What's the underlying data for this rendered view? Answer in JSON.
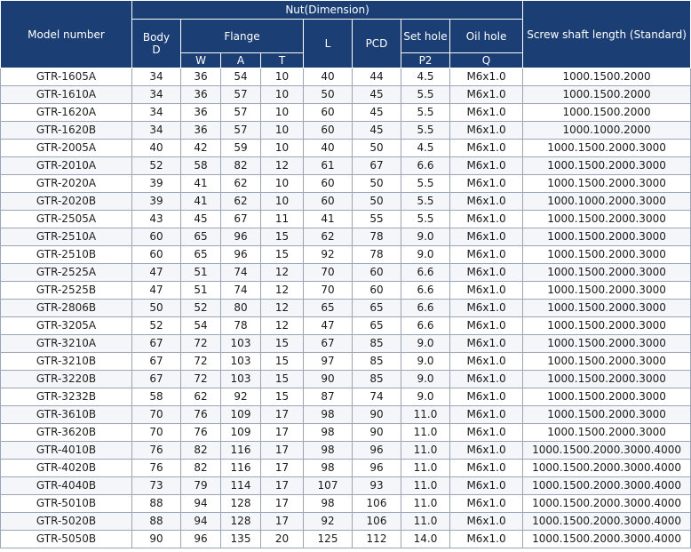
{
  "header": {
    "model_number": "Model number",
    "nut_dimension": "Nut(Dimension)",
    "body": "Body",
    "body_sub": "D",
    "flange": "Flange",
    "flange_w": "W",
    "flange_a": "A",
    "flange_t": "T",
    "l": "L",
    "pcd": "PCD",
    "set_hole": "Set hole",
    "set_hole_sub": "P2",
    "oil_hole": "Oil hole",
    "oil_hole_sub": "Q",
    "screw_shaft": "Screw shaft length (Standard)"
  },
  "rows": [
    {
      "model": "GTR-1605A",
      "d": "34",
      "w": "36",
      "a": "54",
      "t": "10",
      "l": "40",
      "pcd": "44",
      "p2": "4.5",
      "q": "M6x1.0",
      "len": "1000.1500.2000"
    },
    {
      "model": "GTR-1610A",
      "d": "34",
      "w": "36",
      "a": "57",
      "t": "10",
      "l": "50",
      "pcd": "45",
      "p2": "5.5",
      "q": "M6x1.0",
      "len": "1000.1500.2000"
    },
    {
      "model": "GTR-1620A",
      "d": "34",
      "w": "36",
      "a": "57",
      "t": "10",
      "l": "60",
      "pcd": "45",
      "p2": "5.5",
      "q": "M6x1.0",
      "len": "1000.1500.2000"
    },
    {
      "model": "GTR-1620B",
      "d": "34",
      "w": "36",
      "a": "57",
      "t": "10",
      "l": "60",
      "pcd": "45",
      "p2": "5.5",
      "q": "M6x1.0",
      "len": "1000.1000.2000"
    },
    {
      "model": "GTR-2005A",
      "d": "40",
      "w": "42",
      "a": "59",
      "t": "10",
      "l": "40",
      "pcd": "50",
      "p2": "4.5",
      "q": "M6x1.0",
      "len": "1000.1500.2000.3000"
    },
    {
      "model": "GTR-2010A",
      "d": "52",
      "w": "58",
      "a": "82",
      "t": "12",
      "l": "61",
      "pcd": "67",
      "p2": "6.6",
      "q": "M6x1.0",
      "len": "1000.1500.2000.3000"
    },
    {
      "model": "GTR-2020A",
      "d": "39",
      "w": "41",
      "a": "62",
      "t": "10",
      "l": "60",
      "pcd": "50",
      "p2": "5.5",
      "q": "M6x1.0",
      "len": "1000.1500.2000.3000"
    },
    {
      "model": "GTR-2020B",
      "d": "39",
      "w": "41",
      "a": "62",
      "t": "10",
      "l": "60",
      "pcd": "50",
      "p2": "5.5",
      "q": "M6x1.0",
      "len": "1000.1000.2000.3000"
    },
    {
      "model": "GTR-2505A",
      "d": "43",
      "w": "45",
      "a": "67",
      "t": "11",
      "l": "41",
      "pcd": "55",
      "p2": "5.5",
      "q": "M6x1.0",
      "len": "1000.1500.2000.3000"
    },
    {
      "model": "GTR-2510A",
      "d": "60",
      "w": "65",
      "a": "96",
      "t": "15",
      "l": "62",
      "pcd": "78",
      "p2": "9.0",
      "q": "M6x1.0",
      "len": "1000.1500.2000.3000"
    },
    {
      "model": "GTR-2510B",
      "d": "60",
      "w": "65",
      "a": "96",
      "t": "15",
      "l": "92",
      "pcd": "78",
      "p2": "9.0",
      "q": "M6x1.0",
      "len": "1000.1500.2000.3000"
    },
    {
      "model": "GTR-2525A",
      "d": "47",
      "w": "51",
      "a": "74",
      "t": "12",
      "l": "70",
      "pcd": "60",
      "p2": "6.6",
      "q": "M6x1.0",
      "len": "1000.1500.2000.3000"
    },
    {
      "model": "GTR-2525B",
      "d": "47",
      "w": "51",
      "a": "74",
      "t": "12",
      "l": "70",
      "pcd": "60",
      "p2": "6.6",
      "q": "M6x1.0",
      "len": "1000.1500.2000.3000"
    },
    {
      "model": "GTR-2806B",
      "d": "50",
      "w": "52",
      "a": "80",
      "t": "12",
      "l": "65",
      "pcd": "65",
      "p2": "6.6",
      "q": "M6x1.0",
      "len": "1000.1500.2000.3000"
    },
    {
      "model": "GTR-3205A",
      "d": "52",
      "w": "54",
      "a": "78",
      "t": "12",
      "l": "47",
      "pcd": "65",
      "p2": "6.6",
      "q": "M6x1.0",
      "len": "1000.1500.2000.3000"
    },
    {
      "model": "GTR-3210A",
      "d": "67",
      "w": "72",
      "a": "103",
      "t": "15",
      "l": "67",
      "pcd": "85",
      "p2": "9.0",
      "q": "M6x1.0",
      "len": "1000.1500.2000.3000"
    },
    {
      "model": "GTR-3210B",
      "d": "67",
      "w": "72",
      "a": "103",
      "t": "15",
      "l": "97",
      "pcd": "85",
      "p2": "9.0",
      "q": "M6x1.0",
      "len": "1000.1500.2000.3000"
    },
    {
      "model": "GTR-3220B",
      "d": "67",
      "w": "72",
      "a": "103",
      "t": "15",
      "l": "90",
      "pcd": "85",
      "p2": "9.0",
      "q": "M6x1.0",
      "len": "1000.1500.2000.3000"
    },
    {
      "model": "GTR-3232B",
      "d": "58",
      "w": "62",
      "a": "92",
      "t": "15",
      "l": "87",
      "pcd": "74",
      "p2": "9.0",
      "q": "M6x1.0",
      "len": "1000.1500.2000.3000"
    },
    {
      "model": "GTR-3610B",
      "d": "70",
      "w": "76",
      "a": "109",
      "t": "17",
      "l": "98",
      "pcd": "90",
      "p2": "11.0",
      "q": "M6x1.0",
      "len": "1000.1500.2000.3000"
    },
    {
      "model": "GTR-3620B",
      "d": "70",
      "w": "76",
      "a": "109",
      "t": "17",
      "l": "98",
      "pcd": "90",
      "p2": "11.0",
      "q": "M6x1.0",
      "len": "1000.1500.2000.3000"
    },
    {
      "model": "GTR-4010B",
      "d": "76",
      "w": "82",
      "a": "116",
      "t": "17",
      "l": "98",
      "pcd": "96",
      "p2": "11.0",
      "q": "M6x1.0",
      "len": "1000.1500.2000.3000.4000"
    },
    {
      "model": "GTR-4020B",
      "d": "76",
      "w": "82",
      "a": "116",
      "t": "17",
      "l": "98",
      "pcd": "96",
      "p2": "11.0",
      "q": "M6x1.0",
      "len": "1000.1500.2000.3000.4000"
    },
    {
      "model": "GTR-4040B",
      "d": "73",
      "w": "79",
      "a": "114",
      "t": "17",
      "l": "107",
      "pcd": "93",
      "p2": "11.0",
      "q": "M6x1.0",
      "len": "1000.1500.2000.3000.4000"
    },
    {
      "model": "GTR-5010B",
      "d": "88",
      "w": "94",
      "a": "128",
      "t": "17",
      "l": "98",
      "pcd": "106",
      "p2": "11.0",
      "q": "M6x1.0",
      "len": "1000.1500.2000.3000.4000"
    },
    {
      "model": "GTR-5020B",
      "d": "88",
      "w": "94",
      "a": "128",
      "t": "17",
      "l": "92",
      "pcd": "106",
      "p2": "11.0",
      "q": "M6x1.0",
      "len": "1000.1500.2000.3000.4000"
    },
    {
      "model": "GTR-5050B",
      "d": "90",
      "w": "96",
      "a": "135",
      "t": "20",
      "l": "125",
      "pcd": "112",
      "p2": "14.0",
      "q": "M6x1.0",
      "len": "1000.1500.2000.3000.4000"
    }
  ]
}
